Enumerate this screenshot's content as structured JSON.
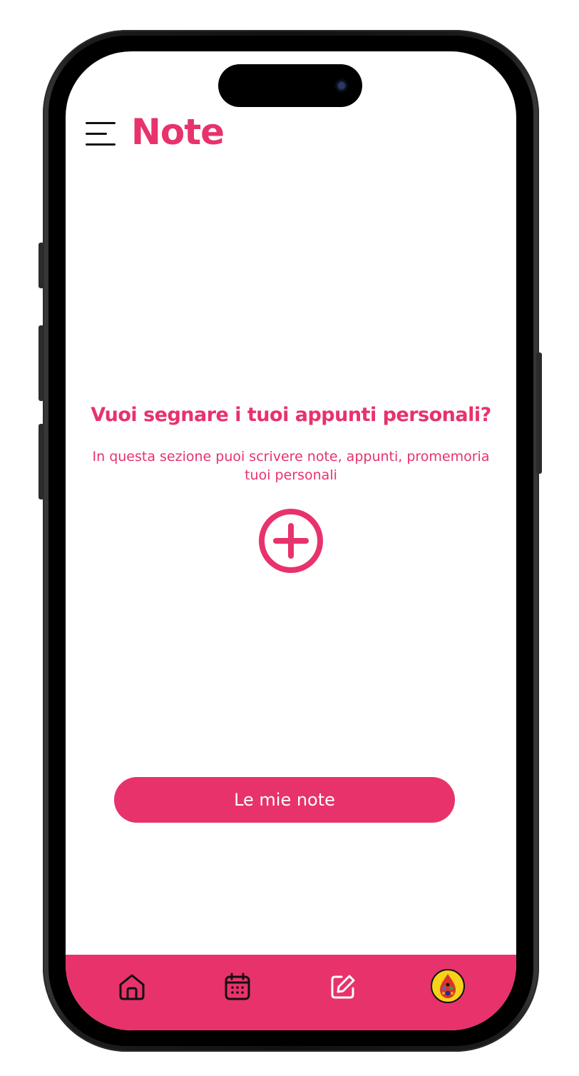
{
  "header": {
    "title": "Note",
    "menu_icon": "hamburger-menu-icon"
  },
  "empty_state": {
    "heading": "Vuoi segnare i tuoi appunti personali?",
    "description_line1": "In questa sezione puoi scrivere note, appunti, promemoria",
    "description_line2": "tuoi personali",
    "add_icon": "plus-circle-icon"
  },
  "primary_button": {
    "label": "Le mie note"
  },
  "tab_bar": {
    "items": [
      {
        "icon": "home-icon"
      },
      {
        "icon": "calendar-icon"
      },
      {
        "icon": "edit-note-icon"
      },
      {
        "icon": "profile-avatar"
      }
    ]
  },
  "colors": {
    "accent": "#e8326b",
    "background": "#ffffff",
    "icon_dark": "#111111",
    "avatar_bg": "#f7d21a"
  }
}
